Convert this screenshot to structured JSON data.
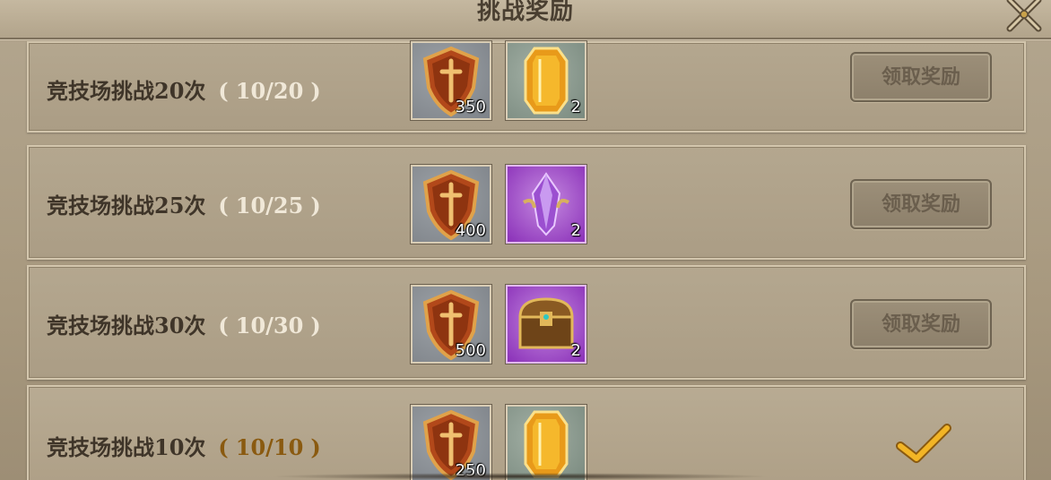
{
  "dialog": {
    "title": "挑战奖励"
  },
  "tasks": [
    {
      "label": "竞技场挑战20次",
      "progress": "10/20",
      "rewards": [
        {
          "icon": "bronze-shield-icon",
          "count": "350"
        },
        {
          "icon": "amber-gem-icon",
          "count": "2"
        }
      ],
      "button": "领取奖励",
      "status": "incomplete"
    },
    {
      "label": "竞技场挑战25次",
      "progress": "10/25",
      "rewards": [
        {
          "icon": "bronze-shield-icon",
          "count": "400"
        },
        {
          "icon": "purple-crystal-icon",
          "count": "2"
        }
      ],
      "button": "领取奖励",
      "status": "incomplete"
    },
    {
      "label": "竞技场挑战30次",
      "progress": "10/30",
      "rewards": [
        {
          "icon": "bronze-shield-icon",
          "count": "500"
        },
        {
          "icon": "treasure-chest-icon",
          "count": "2"
        }
      ],
      "button": "领取奖励",
      "status": "incomplete"
    },
    {
      "label": "竞技场挑战10次",
      "progress": "10/10",
      "rewards": [
        {
          "icon": "bronze-shield-icon",
          "count": "250"
        },
        {
          "icon": "amber-gem-icon",
          "count": ""
        }
      ],
      "status": "claimed"
    }
  ],
  "colors": {
    "progress_incomplete": "#f0e8d8",
    "progress_complete": "#8a5a10",
    "checkmark": "#f2b526"
  }
}
